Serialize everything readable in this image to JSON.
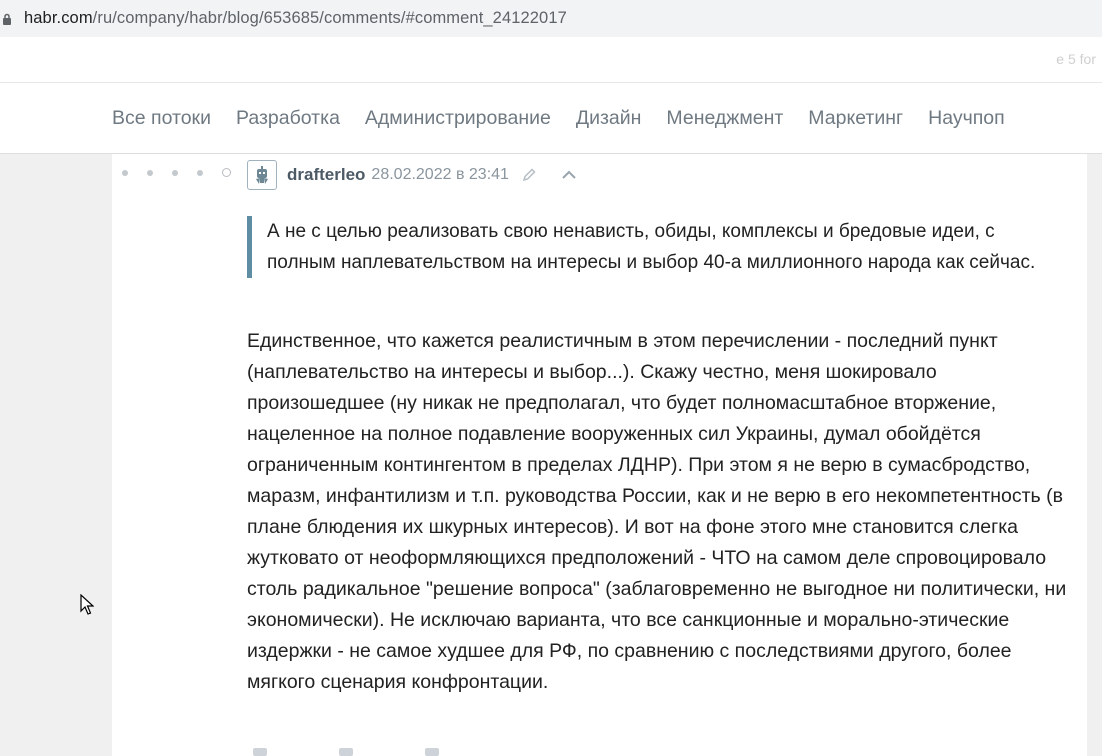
{
  "browser": {
    "url_host": "habr.com",
    "url_path": "/ru/company/habr/blog/653685/comments/#comment_24122017"
  },
  "top_strip": {
    "faint_text": "e 5 for"
  },
  "nav": {
    "items": [
      "Все потоки",
      "Разработка",
      "Администрирование",
      "Дизайн",
      "Менеджмент",
      "Маркетинг",
      "Научпоп"
    ]
  },
  "comment": {
    "author": "drafterleo",
    "timestamp": "28.02.2022 в 23:41",
    "quote": " А не с целью реализовать свою ненависть, обиды, комплексы и бредовые идеи, с полным наплевательством на интересы и выбор 40-а миллионного народа как сейчас.",
    "body": "Единственное, что кажется реалистичным в этом перечислении - последний пункт (наплевательство на интересы и выбор...). Скажу честно, меня шокировало произошедшее (ну никак не предполагал, что будет полномасштабное вторжение, нацеленное на полное подавление вооруженных сил Украины, думал обойдётся ограниченным контингентом в пределах ЛДНР). При этом я не верю в сумасбродство, маразм, инфантилизм и т.п. руководства России, как и не верю в его некомпетентность (в плане блюдения их шкурных интересов). И вот на фоне этого мне становится слегка жутковато от неоформляющихся предположений - ЧТО на самом деле спровоцировало столь радикальное \"решение вопроса\" (заблаговременно не выгодное ни политически, ни экономически). Не исключаю варианта, что все санкционные и морально-этические издержки - не самое худшее для РФ, по сравнению с последствиями другого, более мягкого сценария конфронтации."
  },
  "colors": {
    "accent_quote_border": "#5e8ca3",
    "nav_text": "#6f7982",
    "background": "#f0f0f0"
  }
}
